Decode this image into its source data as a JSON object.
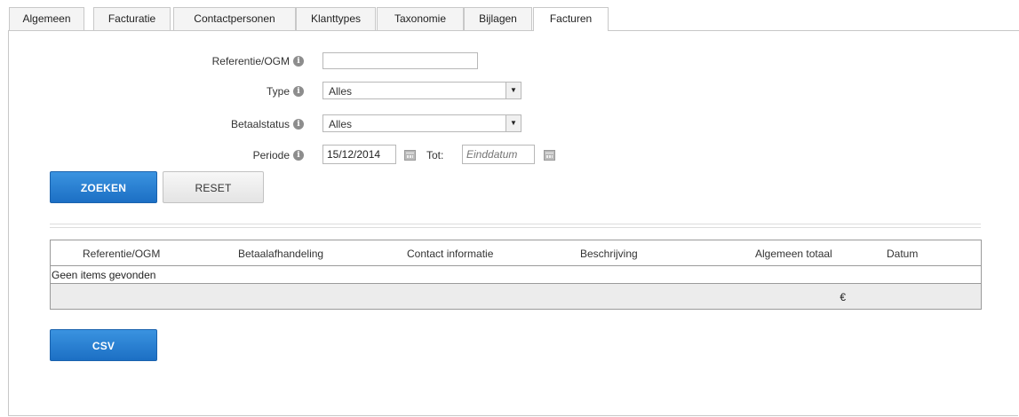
{
  "tabs": [
    {
      "label": "Algemeen",
      "active": false
    },
    {
      "label": "Facturatie",
      "active": false
    },
    {
      "label": "Contactpersonen",
      "active": false
    },
    {
      "label": "Klanttypes",
      "active": false
    },
    {
      "label": "Taxonomie",
      "active": false
    },
    {
      "label": "Bijlagen",
      "active": false
    },
    {
      "label": "Facturen",
      "active": true
    }
  ],
  "form": {
    "reference": {
      "label": "Referentie/OGM",
      "value": ""
    },
    "type": {
      "label": "Type",
      "value": "Alles"
    },
    "payment_status": {
      "label": "Betaalstatus",
      "value": "Alles"
    },
    "period": {
      "label": "Periode",
      "start_value": "15/12/2014",
      "to_label": "Tot:",
      "end_placeholder": "Einddatum"
    }
  },
  "buttons": {
    "search": "ZOEKEN",
    "reset": "RESET",
    "csv": "CSV"
  },
  "table": {
    "columns": [
      "Referentie/OGM",
      "Betaalafhandeling",
      "Contact informatie",
      "Beschrijving",
      "Algemeen totaal",
      "Datum"
    ],
    "empty_message": "Geen items gevonden",
    "total_currency": "€"
  },
  "colors": {
    "primary": "#2a80d2",
    "border": "#c8c8c8",
    "total_row_bg": "#ececec"
  }
}
